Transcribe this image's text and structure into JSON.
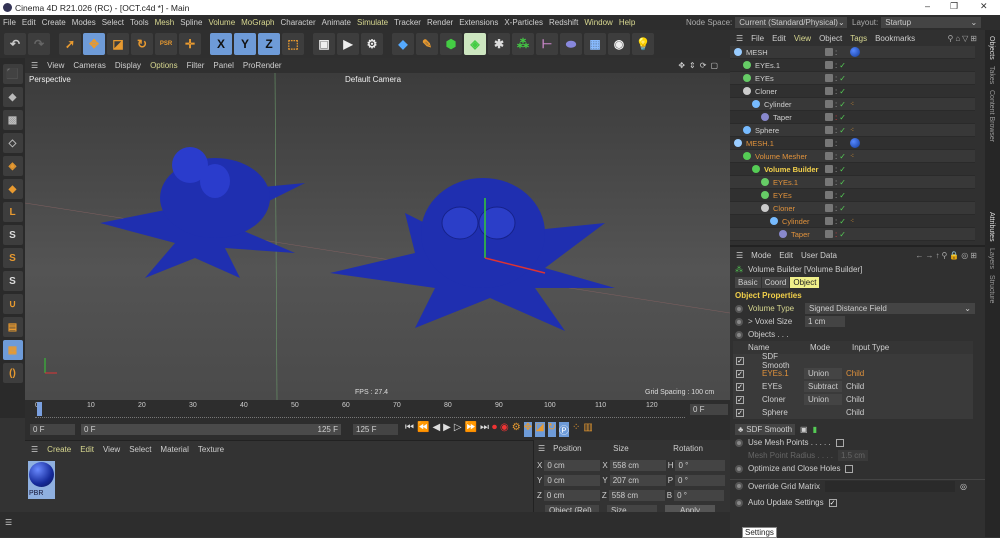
{
  "window": {
    "title": "Cinema 4D R21.026 (RC) - [OCT.c4d *] - Main",
    "minimize": "–",
    "restore": "❐",
    "close": "✕"
  },
  "menu": [
    "File",
    "Edit",
    "Create",
    "Modes",
    "Select",
    "Tools",
    "Mesh",
    "Spline",
    "Volume",
    "MoGraph",
    "Character",
    "Animate",
    "Simulate",
    "Tracker",
    "Render",
    "Extensions",
    "X-Particles",
    "Redshift",
    "Window",
    "Help"
  ],
  "node_space": {
    "label": "Node Space:",
    "value": "Current (Standard/Physical)"
  },
  "layout": {
    "label": "Layout:",
    "value": "Startup"
  },
  "toolbar": {
    "x": "X",
    "y": "Y",
    "z": "Z",
    "psr": "PSR"
  },
  "viewport": {
    "menu": [
      "View",
      "Cameras",
      "Display",
      "Options",
      "Filter",
      "Panel",
      "ProRender"
    ],
    "name": "Perspective",
    "camera": "Default Camera",
    "fps": "FPS : 27.4",
    "grid": "Grid Spacing : 100 cm"
  },
  "timeline": {
    "ticks": [
      "0",
      "10",
      "20",
      "30",
      "40",
      "50",
      "60",
      "70",
      "80",
      "90",
      "100",
      "110",
      "120"
    ],
    "current_frame": "0 F",
    "start": "0 F",
    "range_start": "0 F",
    "range_end": "125 F",
    "end": "125 F"
  },
  "materials": {
    "menu": [
      "Create",
      "Edit",
      "View",
      "Select",
      "Material",
      "Texture"
    ],
    "items": [
      {
        "name": "PBR"
      }
    ]
  },
  "coordinates": {
    "headers": [
      "Position",
      "Size",
      "Rotation"
    ],
    "rows": [
      {
        "axis": "X",
        "pos": "0 cm",
        "saxis": "X",
        "size": "558 cm",
        "raxis": "H",
        "rot": "0 °"
      },
      {
        "axis": "Y",
        "pos": "0 cm",
        "saxis": "Y",
        "size": "207 cm",
        "raxis": "P",
        "rot": "0 °"
      },
      {
        "axis": "Z",
        "pos": "0 cm",
        "saxis": "Z",
        "size": "558 cm",
        "raxis": "B",
        "rot": "0 °"
      }
    ],
    "mode": "Object (Rel)",
    "size_mode": "Size",
    "apply": "Apply"
  },
  "objects": {
    "menu": [
      "File",
      "Edit",
      "View",
      "Object",
      "Tags",
      "Bookmarks"
    ],
    "items": [
      {
        "name": "MESH",
        "depth": 0,
        "style": "normal",
        "icon": "#9cf",
        "tag": "ball"
      },
      {
        "name": "EYEs.1",
        "depth": 1,
        "style": "normal",
        "icon": "#6c6",
        "tag": ""
      },
      {
        "name": "EYEs",
        "depth": 1,
        "style": "normal",
        "icon": "#6c6",
        "tag": ""
      },
      {
        "name": "Cloner",
        "depth": 1,
        "style": "normal",
        "icon": "#ccc",
        "tag": ""
      },
      {
        "name": "Cylinder",
        "depth": 2,
        "style": "normal",
        "icon": "#7bf",
        "tag": "dots"
      },
      {
        "name": "Taper",
        "depth": 3,
        "style": "normal",
        "icon": "#88c",
        "tag": ""
      },
      {
        "name": "Sphere",
        "depth": 1,
        "style": "normal",
        "icon": "#7bf",
        "tag": "dots"
      },
      {
        "name": "MESH.1",
        "depth": 0,
        "style": "orange",
        "icon": "#9cf",
        "tag": "ball"
      },
      {
        "name": "Volume Mesher",
        "depth": 1,
        "style": "orange",
        "icon": "#5c5",
        "tag": "dots"
      },
      {
        "name": "Volume Builder",
        "depth": 2,
        "style": "yellow",
        "icon": "#5c5",
        "tag": ""
      },
      {
        "name": "EYEs.1",
        "depth": 3,
        "style": "orange",
        "icon": "#6c6",
        "tag": ""
      },
      {
        "name": "EYEs",
        "depth": 3,
        "style": "orange",
        "icon": "#6c6",
        "tag": ""
      },
      {
        "name": "Cloner",
        "depth": 3,
        "style": "orange",
        "icon": "#ccc",
        "tag": ""
      },
      {
        "name": "Cylinder",
        "depth": 4,
        "style": "orange",
        "icon": "#7bf",
        "tag": "dots"
      },
      {
        "name": "Taper",
        "depth": 5,
        "style": "orange",
        "icon": "#88c",
        "tag": ""
      }
    ]
  },
  "attributes": {
    "menu": [
      "Mode",
      "Edit",
      "User Data"
    ],
    "object_title": "Volume Builder [Volume Builder]",
    "tabs": [
      "Basic",
      "Coord",
      "Object"
    ],
    "section": "Object Properties",
    "volume_type": {
      "label": "Volume Type",
      "value": "Signed Distance Field"
    },
    "voxel_size": {
      "label": "> Voxel Size",
      "value": "1 cm"
    },
    "objects_label": "Objects . . .",
    "list_headers": [
      "Name",
      "Mode",
      "Input Type"
    ],
    "list": [
      {
        "name": "SDF Smooth",
        "mode": "",
        "input": ""
      },
      {
        "name": "EYEs.1",
        "mode": "Union",
        "input": "Child"
      },
      {
        "name": "EYEs",
        "mode": "Subtract",
        "input": "Child"
      },
      {
        "name": "Cloner",
        "mode": "Union",
        "input": "Child"
      },
      {
        "name": "Sphere",
        "mode": "",
        "input": "Child"
      }
    ],
    "sdf_smooth": "SDF Smooth",
    "use_mesh_points": "Use Mesh Points . . . . .",
    "mesh_point_radius": {
      "label": "Mesh Point Radius . . . .",
      "value": "1.5 cm"
    },
    "optimize": "Optimize and Close Holes",
    "override": "Override Grid Matrix",
    "auto_update": "Auto Update Settings",
    "tooltip": "Settings"
  },
  "side_tabs": [
    "Objects",
    "Takes",
    "Content Browser",
    "Attributes",
    "Layers",
    "Structure"
  ]
}
